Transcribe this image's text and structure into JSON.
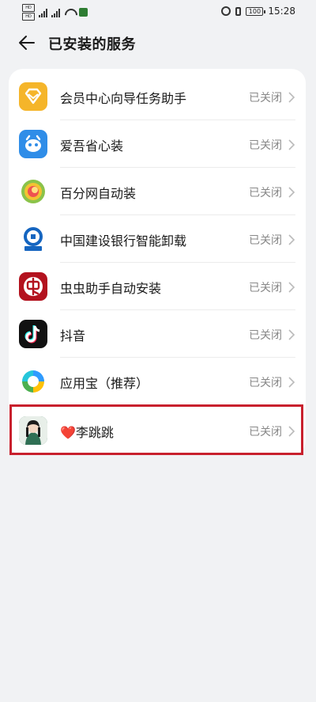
{
  "status_bar": {
    "sim1": "HD",
    "sim2": "HD",
    "network": "5G",
    "battery": "100",
    "time": "15:28"
  },
  "header": {
    "title": "已安装的服务"
  },
  "services": [
    {
      "name": "会员中心向导任务助手",
      "status": "已关闭",
      "icon": "vip-diamond-icon",
      "color": "#f5b52a"
    },
    {
      "name": "爱吾省心装",
      "status": "已关闭",
      "icon": "aiwu-app-icon",
      "color": "#2f8de8"
    },
    {
      "name": "百分网自动装",
      "status": "已关闭",
      "icon": "baifen-app-icon",
      "color": "#f3c332"
    },
    {
      "name": "中国建设银行智能卸载",
      "status": "已关闭",
      "icon": "ccb-bank-icon",
      "color": "#1565c0"
    },
    {
      "name": "虫虫助手自动安装",
      "status": "已关闭",
      "icon": "chongchong-app-icon",
      "color": "#b3121e"
    },
    {
      "name": "抖音",
      "status": "已关闭",
      "icon": "douyin-app-icon",
      "color": "#111111"
    },
    {
      "name": "应用宝（推荐）",
      "status": "已关闭",
      "icon": "yingyongbao-app-icon",
      "color": "#2f9bff"
    },
    {
      "name": "❤️李跳跳",
      "status": "已关闭",
      "icon": "litiaotiao-app-icon",
      "color": "#2f6f54"
    }
  ],
  "highlight_color": "#c8202d"
}
